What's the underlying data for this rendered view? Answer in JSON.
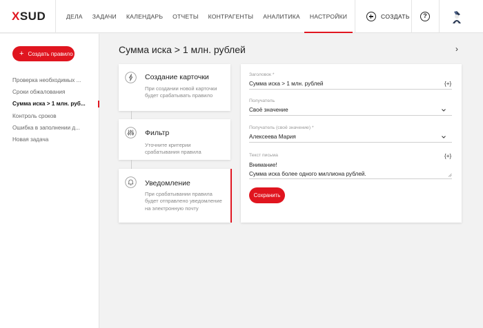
{
  "header": {
    "logo": "SUD",
    "logo_mark": "X",
    "nav": [
      {
        "label": "ДЕЛА"
      },
      {
        "label": "ЗАДАЧИ"
      },
      {
        "label": "КАЛЕНДАРЬ"
      },
      {
        "label": "ОТЧЕТЫ"
      },
      {
        "label": "КОНТРАГЕНТЫ"
      },
      {
        "label": "АНАЛИТИКА"
      },
      {
        "label": "НАСТРОЙКИ",
        "active": true
      }
    ],
    "create_label": "СОЗДАТЬ",
    "help_label": "?"
  },
  "sidebar": {
    "create_button": "Создать правило",
    "items": [
      {
        "label": "Проверка необходимых ..."
      },
      {
        "label": "Сроки обжалования"
      },
      {
        "label": "Сумма иска > 1 млн. руб...",
        "active": true
      },
      {
        "label": "Контроль сроков"
      },
      {
        "label": "Ошибка в заполнении д..."
      },
      {
        "label": "Новая задача"
      }
    ]
  },
  "main": {
    "title": "Сумма иска > 1 млн. рублей",
    "steps": [
      {
        "title": "Создание карточки",
        "desc": "При создании новой карточки будет срабатывать правило",
        "icon": "lightning-icon"
      },
      {
        "title": "Фильтр",
        "desc": "Уточните критерии срабатывания правила",
        "icon": "filter-sliders-icon"
      },
      {
        "title": "Уведомление",
        "desc": "При срабатывании правила будет отправлено уведомление на электронную почту",
        "icon": "bell-icon",
        "active": true
      }
    ],
    "form": {
      "subject": {
        "label": "Заголовок *",
        "value": "Сумма иска > 1 млн. рублей",
        "var": "{+}"
      },
      "recipient": {
        "label": "Получатель",
        "value": "Своё значение"
      },
      "recipient_custom": {
        "label": "Получатель (своё значение) *",
        "value": "Алексеева Мария"
      },
      "body": {
        "label": "Текст письма",
        "var": "{+}",
        "line1": "Внимание!",
        "line2": "Сумма иска более одного миллиона рублей."
      },
      "save_button": "Сохранить"
    }
  },
  "colors": {
    "accent": "#e0151f"
  }
}
